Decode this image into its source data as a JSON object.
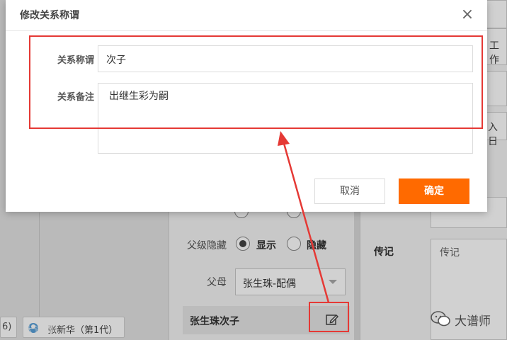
{
  "background": {
    "row_parent_hidden": {
      "label": "父级隐藏",
      "opt_show": "显示",
      "opt_hide": "隐藏"
    },
    "row_parents": {
      "label": "父母",
      "value": "张生珠-配偶"
    },
    "row_entry": {
      "label": "张生珠次子"
    },
    "right_panel": {
      "label_bio": "传记",
      "bio_placeholder": "传记",
      "frag_work": "工作",
      "frag_date": "入日"
    },
    "chips": {
      "left_fragment": "6)",
      "person": "张新华（第1代）"
    },
    "watermark": "大谱师",
    "watermark_faded": "大谱师"
  },
  "modal": {
    "title": "修改关系称谓",
    "fields": {
      "title_label": "关系称谓",
      "title_value": "次子",
      "note_label": "关系备注",
      "note_value": "出继生彩为嗣"
    },
    "buttons": {
      "cancel": "取消",
      "ok": "确定"
    }
  },
  "colors": {
    "accent": "#ff6a00",
    "annotation": "#e53935"
  },
  "icons": [
    "close-icon",
    "edit-icon",
    "chevron-down-icon",
    "wechat-icon",
    "avatar-icon"
  ]
}
